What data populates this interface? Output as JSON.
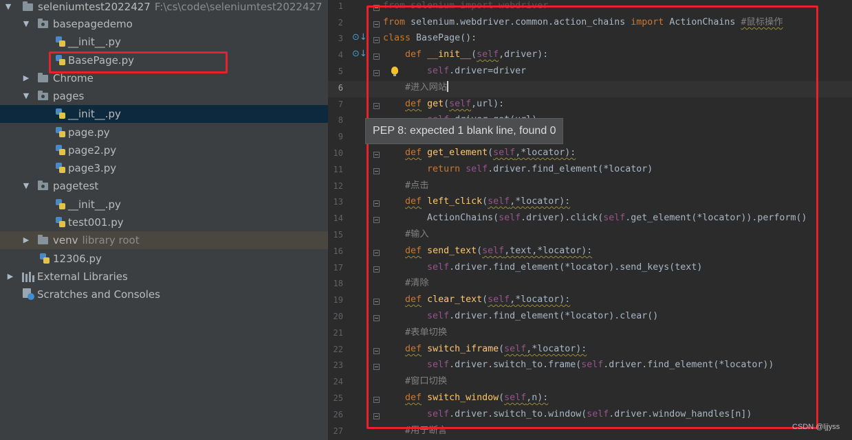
{
  "project_tree": {
    "root": {
      "name": "seleniumtest2022427",
      "path": "F:\\cs\\code\\seleniumtest2022427"
    },
    "basepagedemo": {
      "name": "basepagedemo",
      "files": [
        "__init__.py",
        "BasePage.py"
      ]
    },
    "chrome": {
      "name": "Chrome"
    },
    "pages": {
      "name": "pages",
      "files": [
        "__init__.py",
        "page.py",
        "page2.py",
        "page3.py"
      ]
    },
    "pagetest": {
      "name": "pagetest",
      "files": [
        "__init__.py",
        "test001.py"
      ]
    },
    "venv": {
      "name": "venv",
      "sub": "library root"
    },
    "root_file": "12306.py",
    "external_libraries": "External Libraries",
    "scratches": "Scratches and Consoles"
  },
  "editor": {
    "line_numbers": [
      "1",
      "2",
      "3",
      "4",
      "5",
      "6",
      "7",
      "8",
      "9",
      "10",
      "11",
      "12",
      "13",
      "14",
      "15",
      "16",
      "17",
      "18",
      "19",
      "20",
      "21",
      "22",
      "23",
      "24",
      "25",
      "26",
      "27"
    ],
    "current_line": "6",
    "tooltip": "PEP 8: expected 1 blank line, found 0",
    "lines": {
      "l1_a": "from",
      "l1_b": " selenium ",
      "l1_c": "import",
      "l1_d": " webdriver",
      "l2_a": "from",
      "l2_b": " selenium.webdriver.common.action_chains ",
      "l2_c": "import",
      "l2_d": " ActionChains ",
      "l2_e": "#鼠标操作",
      "l3_a": "class",
      "l3_b": " BasePage():",
      "l4_a": "def",
      "l4_b": "__init__",
      "l4_c": "(",
      "l4_d": "self",
      "l4_e": ",driver):",
      "l5_a": "self",
      "l5_b": ".driver=driver",
      "l6_a": "#进入网站",
      "l7_a": "def",
      "l7_b": "get",
      "l7_c": "(",
      "l7_d": "self",
      "l7_e": ",url):",
      "l8_a": "self",
      "l8_b": ".driver.get(url)",
      "l10_a": "def",
      "l10_b": "get_element",
      "l10_c": "(",
      "l10_d": "self",
      "l10_e": ",*locator):",
      "l11_a": "return",
      "l11_b": " ",
      "l11_c": "self",
      "l11_d": ".driver.find_element(*locator)",
      "l12_a": "#点击",
      "l13_a": "def",
      "l13_b": "left_click",
      "l13_c": "(",
      "l13_d": "self",
      "l13_e": ",*locator):",
      "l14_a": "ActionChains(",
      "l14_b": "self",
      "l14_c": ".driver).click(",
      "l14_d": "self",
      "l14_e": ".get_element(*locator)).perform()",
      "l15_a": "#输入",
      "l16_a": "def",
      "l16_b": "send_text",
      "l16_c": "(",
      "l16_d": "self",
      "l16_e": ",text,*locator):",
      "l17_a": "self",
      "l17_b": ".driver.find_element(*locator).send_keys(text)",
      "l18_a": "#清除",
      "l19_a": "def",
      "l19_b": "clear_text",
      "l19_c": "(",
      "l19_d": "self",
      "l19_e": ",*locator):",
      "l20_a": "self",
      "l20_b": ".driver.find_element(*locator).clear()",
      "l21_a": "#表单切换",
      "l22_a": "def",
      "l22_b": "switch_iframe",
      "l22_c": "(",
      "l22_d": "self",
      "l22_e": ",*locator):",
      "l23_a": "self",
      "l23_b": ".driver.switch_to.frame(",
      "l23_c": "self",
      "l23_d": ".driver.find_element(*locator))",
      "l24_a": "#窗口切换",
      "l25_a": "def",
      "l25_b": "switch_window",
      "l25_c": "(",
      "l25_d": "self",
      "l25_e": ",n):",
      "l26_a": "self",
      "l26_b": ".driver.switch_to.window(",
      "l26_c": "self",
      "l26_d": ".driver.window_handles[n])",
      "l27_a": "#用于断言"
    }
  },
  "watermark": "CSDN @ljjyss",
  "colors": {
    "highlight_box": "#e8222b",
    "keyword": "#cc7832",
    "function_name": "#ffc66d",
    "self_keyword": "#94558d",
    "comment": "#808080",
    "tree_selection": "#0d293e"
  }
}
